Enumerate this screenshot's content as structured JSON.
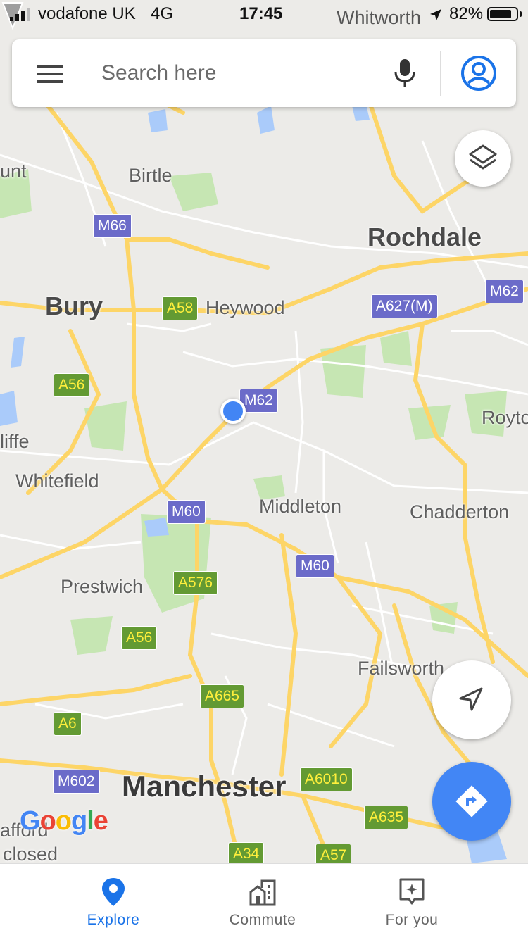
{
  "status_bar": {
    "carrier": "vodafone UK",
    "network": "4G",
    "time": "17:45",
    "location": "Whitworth",
    "battery_percent": "82%",
    "battery_level": 0.82,
    "signal_bars": 3
  },
  "search": {
    "placeholder": "Search here",
    "icons": {
      "menu": "menu-icon",
      "mic": "mic-icon",
      "account": "account-icon"
    }
  },
  "map": {
    "places": [
      {
        "name": "Birtle",
        "kind": "town"
      },
      {
        "name": "Rochdale",
        "kind": "city"
      },
      {
        "name": "Bury",
        "kind": "city"
      },
      {
        "name": "Heywood",
        "kind": "town"
      },
      {
        "name": "Royto",
        "kind": "town"
      },
      {
        "name": "liffe",
        "kind": "town"
      },
      {
        "name": "Whitefield",
        "kind": "town"
      },
      {
        "name": "Middleton",
        "kind": "town"
      },
      {
        "name": "Chadderton",
        "kind": "town"
      },
      {
        "name": "Prestwich",
        "kind": "town"
      },
      {
        "name": "Failsworth",
        "kind": "town"
      },
      {
        "name": "Manchester",
        "kind": "major"
      },
      {
        "name": "afford",
        "kind": "town"
      },
      {
        "name": "closed",
        "kind": "town"
      },
      {
        "name": "unt",
        "kind": "town"
      }
    ],
    "road_shields": [
      {
        "label": "M66",
        "type": "motorway"
      },
      {
        "label": "A58",
        "type": "a-road"
      },
      {
        "label": "A627(M)",
        "type": "motorway"
      },
      {
        "label": "M62",
        "type": "motorway"
      },
      {
        "label": "A56",
        "type": "a-road"
      },
      {
        "label": "M62",
        "type": "motorway"
      },
      {
        "label": "M60",
        "type": "motorway"
      },
      {
        "label": "M60",
        "type": "motorway"
      },
      {
        "label": "A576",
        "type": "a-road"
      },
      {
        "label": "A56",
        "type": "a-road"
      },
      {
        "label": "A665",
        "type": "a-road"
      },
      {
        "label": "A6",
        "type": "a-road"
      },
      {
        "label": "M602",
        "type": "motorway"
      },
      {
        "label": "A6010",
        "type": "a-road"
      },
      {
        "label": "A635",
        "type": "a-road"
      },
      {
        "label": "A34",
        "type": "a-road"
      },
      {
        "label": "A57",
        "type": "a-road"
      }
    ],
    "logo": "Google",
    "colors": {
      "land": "#ecebe8",
      "road": "#fdd567",
      "minor_road": "#ffffff",
      "park": "#c6e6b3",
      "water": "#aacbfa",
      "motorway_shield": "#6b6bc9",
      "a_road_shield": "#639a33",
      "accent": "#4285f4"
    }
  },
  "controls": {
    "layers": "layers-icon",
    "recenter": "navigation-arrow-icon",
    "directions": "directions-icon"
  },
  "bottom_nav": {
    "items": [
      {
        "label": "Explore",
        "icon": "location-pin-icon",
        "active": true
      },
      {
        "label": "Commute",
        "icon": "commute-buildings-icon",
        "active": false
      },
      {
        "label": "For you",
        "icon": "sparkle-icon",
        "active": false
      }
    ]
  }
}
